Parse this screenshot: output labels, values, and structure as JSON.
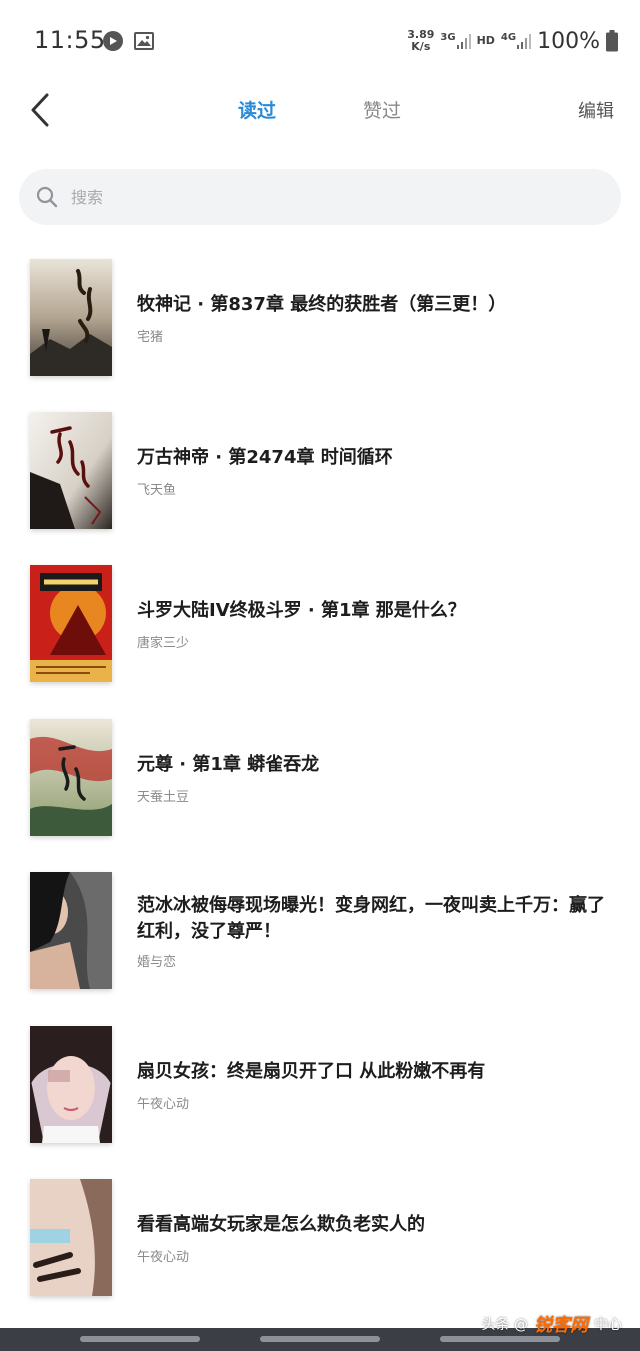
{
  "status_bar": {
    "time": "11:55",
    "net_speed_value": "3.89",
    "net_speed_unit": "K/s",
    "network_3g": "3G",
    "hd_label": "HD",
    "network_4g": "4G",
    "battery_percent": "100%"
  },
  "nav": {
    "tab_read": "读过",
    "tab_liked": "赞过",
    "edit_label": "编辑"
  },
  "search": {
    "placeholder": "搜索"
  },
  "items": [
    {
      "title": "牧神记 · 第837章 最终的获胜者（第三更！）",
      "author": "宅猪"
    },
    {
      "title": "万古神帝 · 第2474章 时间循环",
      "author": "飞天鱼"
    },
    {
      "title": "斗罗大陆IV终极斗罗 · 第1章 那是什么？",
      "author": "唐家三少"
    },
    {
      "title": "元尊 · 第1章 蟒雀吞龙",
      "author": "天蚕土豆"
    },
    {
      "title": "范冰冰被侮辱现场曝光！变身网红，一夜叫卖上千万：赢了红利，没了尊严！",
      "author": "婚与恋"
    },
    {
      "title": "扇贝女孩：终是扇贝开了口 从此粉嫩不再有",
      "author": "午夜心动"
    },
    {
      "title": "看看高端女玩家是怎么欺负老实人的",
      "author": "午夜心动"
    }
  ],
  "watermark": {
    "source": "头条 @",
    "site": "锐客网",
    "suffix": "中心"
  },
  "colors": {
    "accent": "#2a8ad6",
    "search_bg": "#f1f3f5"
  }
}
